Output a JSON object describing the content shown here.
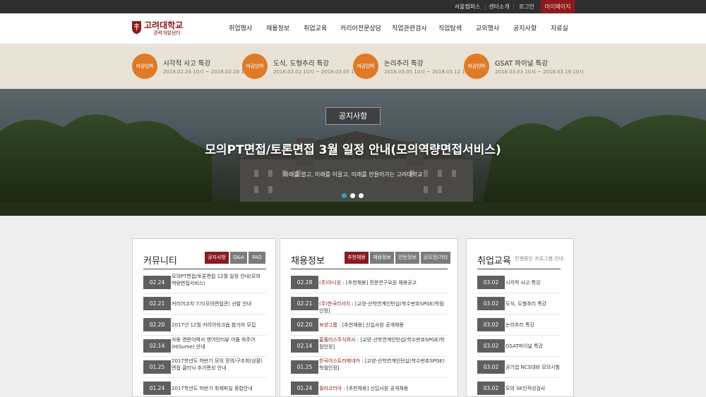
{
  "topbar": {
    "links": [
      "서울캠퍼스",
      "센터소개",
      "로그인"
    ],
    "mypage": "마이페이지"
  },
  "logo": {
    "name": "고려대학교",
    "sub": "경력개발센터"
  },
  "nav": [
    "취업행사",
    "채용정보",
    "취업교육",
    "커리어전문상담",
    "직업관련검사",
    "직업탐색",
    "교외행사",
    "공지사항",
    "자료실"
  ],
  "deadlines": [
    {
      "badge": "마감임박",
      "title": "시각적 사고 특강",
      "date": "2018.02.24 10시 ~ 2018.02.28 10시"
    },
    {
      "badge": "마감임박",
      "title": "도식, 도형추리 특강",
      "date": "2018.03.02 10시 ~ 2018.03.05 10시"
    },
    {
      "badge": "마감임박",
      "title": "논리추리 특강",
      "date": "2018.03.05 10시 ~ 2018.03.12 10시"
    },
    {
      "badge": "마감임박",
      "title": "GSAT 파이널 특강",
      "date": "2018.03.03 10시 ~ 2018.03.16 10시"
    }
  ],
  "hero": {
    "tag": "공지사항",
    "headline": "모의PT면접/토론면접 3월 일정 안내(모의역량면접서비스)",
    "subline": "미래를 열고, 미래를 이끌고, 미래를 만들어가는 고려대학교"
  },
  "community": {
    "title": "커뮤니티",
    "tabs": [
      "공지사항",
      "Q&A",
      "FAQ"
    ],
    "rows": [
      {
        "date": "02.24",
        "text": "모의PT면접/토론면접 12월 일정 안내(모의역량면접서비스)"
      },
      {
        "date": "02.21",
        "text": "커리어코치 7기(모의면접관) 선발 안내"
      },
      {
        "date": "02.20",
        "text": "2017년 12월 커리어워크숍 참가자 모집"
      },
      {
        "date": "02.14",
        "text": "자동 영문이력서 영어인터뷰 어플 하주어(HiSume) 안내"
      },
      {
        "date": "01.25",
        "text": "2017학년도 하반기 모의 장의/구조회(상황) 면접 클리닉 추가편성 안내"
      },
      {
        "date": "01.24",
        "text": "2017학년도 하반기 취재파일 종합안내"
      }
    ]
  },
  "jobs": {
    "title": "채용정보",
    "tabs": [
      "추천채용",
      "채용정보",
      "인턴정보",
      "공모전/기타"
    ],
    "rows": [
      {
        "date": "02.28",
        "company": "(주)아니원",
        "text": " : [추천채용] 전문연구요원 채용공고"
      },
      {
        "date": "02.21",
        "company": "(주)한국리서치",
        "text": " : [교양-산학연계인턴십(학수번호SPGE)학점인정]"
      },
      {
        "date": "02.20",
        "company": "보성그룹",
        "text": " : [추천채용] 신입사원 공개채용"
      },
      {
        "date": "02.14",
        "company": "홈플러스주식회사",
        "text": " : [교양-산학연계인턴십(학수번호SPGE)학점인정]"
      },
      {
        "date": "01.25",
        "company": "한국어스트라제네카",
        "text": " : [교양-산학연계인턴십(학수번호SPGE)학점인정]"
      },
      {
        "date": "01.24",
        "company": "휠라코리아",
        "text": " : [추천채용] 신입사원 공개채용"
      }
    ]
  },
  "education": {
    "title": "취업교육",
    "hint": "진행중인 프로그램 안내",
    "rows": [
      {
        "date": "03.02",
        "text": "시각적 사고 특강"
      },
      {
        "date": "03.02",
        "text": "도식, 도형추리 특강"
      },
      {
        "date": "03.02",
        "text": "논리추리 특강"
      },
      {
        "date": "03.02",
        "text": "GSAT파이널 특강"
      },
      {
        "date": "03.02",
        "text": "공기업 NCS대비 모의시험"
      },
      {
        "date": "03.02",
        "text": "모의 SK인적성검사"
      }
    ]
  },
  "colors": {
    "accent": "#8a1a1f",
    "badge": "#e07a25",
    "dot_active": "#2aa6c8",
    "topbar": "#2f2f2f"
  }
}
